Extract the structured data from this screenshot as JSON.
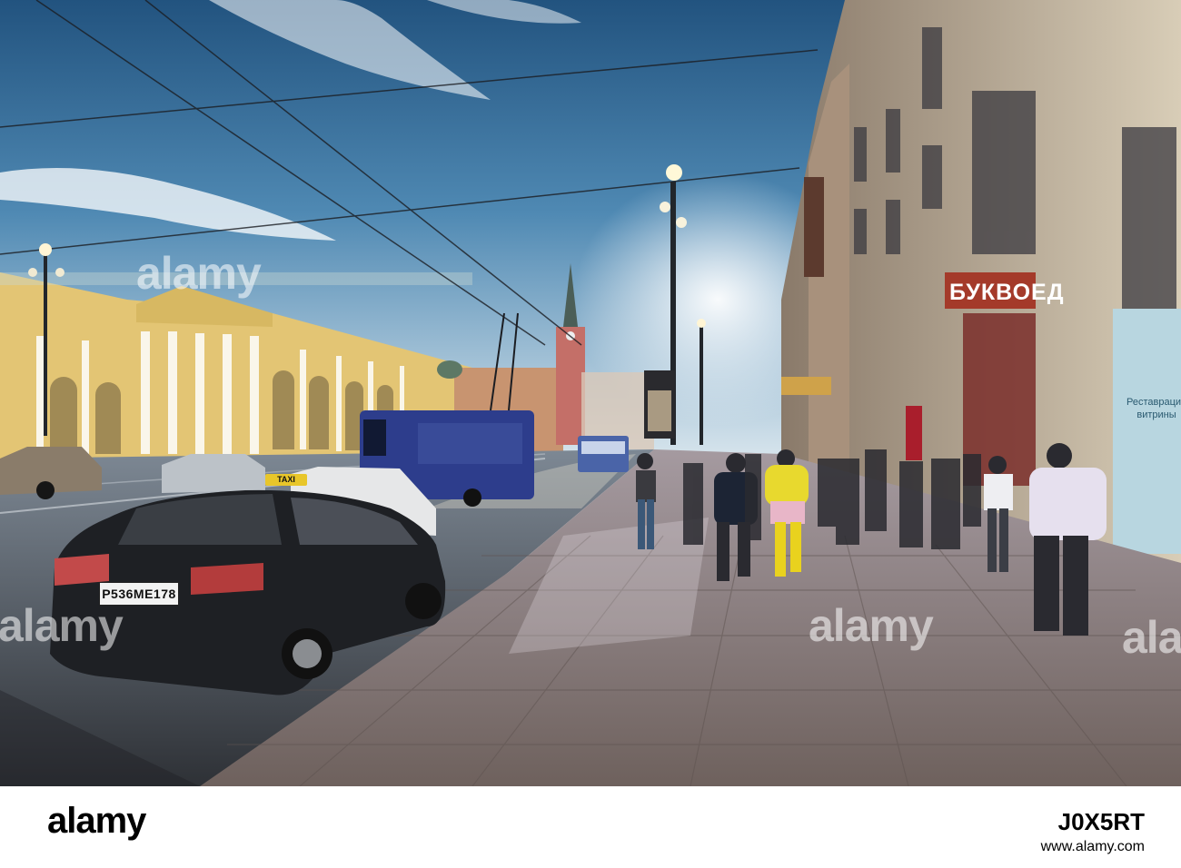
{
  "watermark": {
    "text": "alamy"
  },
  "signs": {
    "bookstore": "БУКВОЕД",
    "restoration_line1": "Реставрация",
    "restoration_line2": "витрины",
    "taxi": "TAXI",
    "plate": "P536ME178"
  },
  "footer": {
    "logo": "alamy",
    "image_id": "J0X5RT",
    "url": "www.alamy.com"
  },
  "colors": {
    "sky_top": "#2b5e8c",
    "sky_bottom": "#cfe3ee",
    "building_yellow": "#e6c873",
    "street": "#3d4147",
    "sidewalk": "#8a7f7a"
  }
}
